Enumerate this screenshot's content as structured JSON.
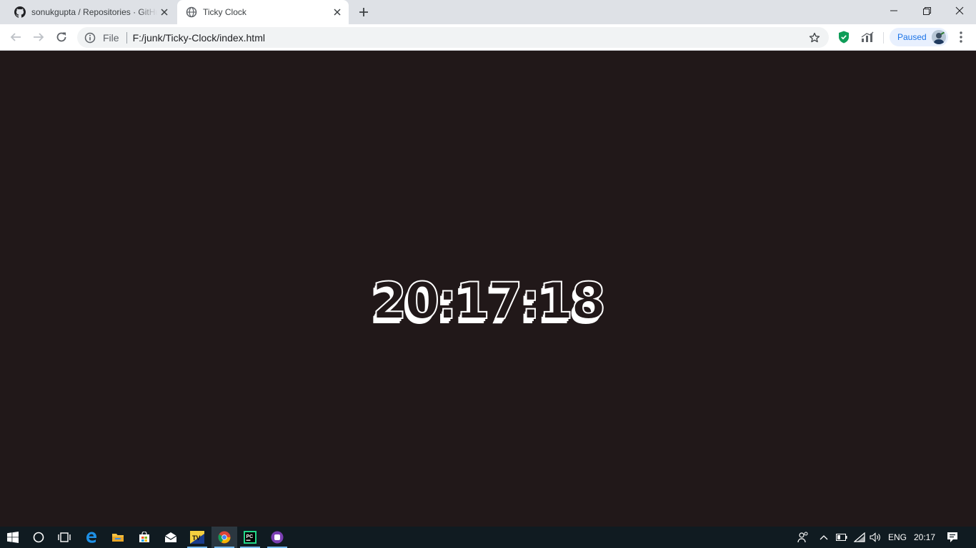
{
  "browser": {
    "tabs": [
      {
        "title": "sonukgupta / Repositories · GitHub",
        "icon": "github-icon",
        "active": false
      },
      {
        "title": "Ticky Clock",
        "icon": "globe-icon",
        "active": true
      }
    ],
    "address_bar": {
      "security_chip": "File",
      "url": "F:/junk/Ticky-Clock/index.html"
    },
    "profile": {
      "label": "Paused"
    }
  },
  "page": {
    "clock_time": "20:17:18",
    "background_color": "#211819",
    "clock_color": "#ffffff"
  },
  "taskbar": {
    "apps": [
      "start-icon",
      "search-icon",
      "task-view-icon",
      "edge-icon",
      "file-explorer-icon",
      "store-icon",
      "mail-icon",
      "tv-app-icon",
      "chrome-icon",
      "pycharm-icon",
      "app-icon"
    ],
    "tray": {
      "language": "ENG",
      "time": "20:17"
    }
  }
}
